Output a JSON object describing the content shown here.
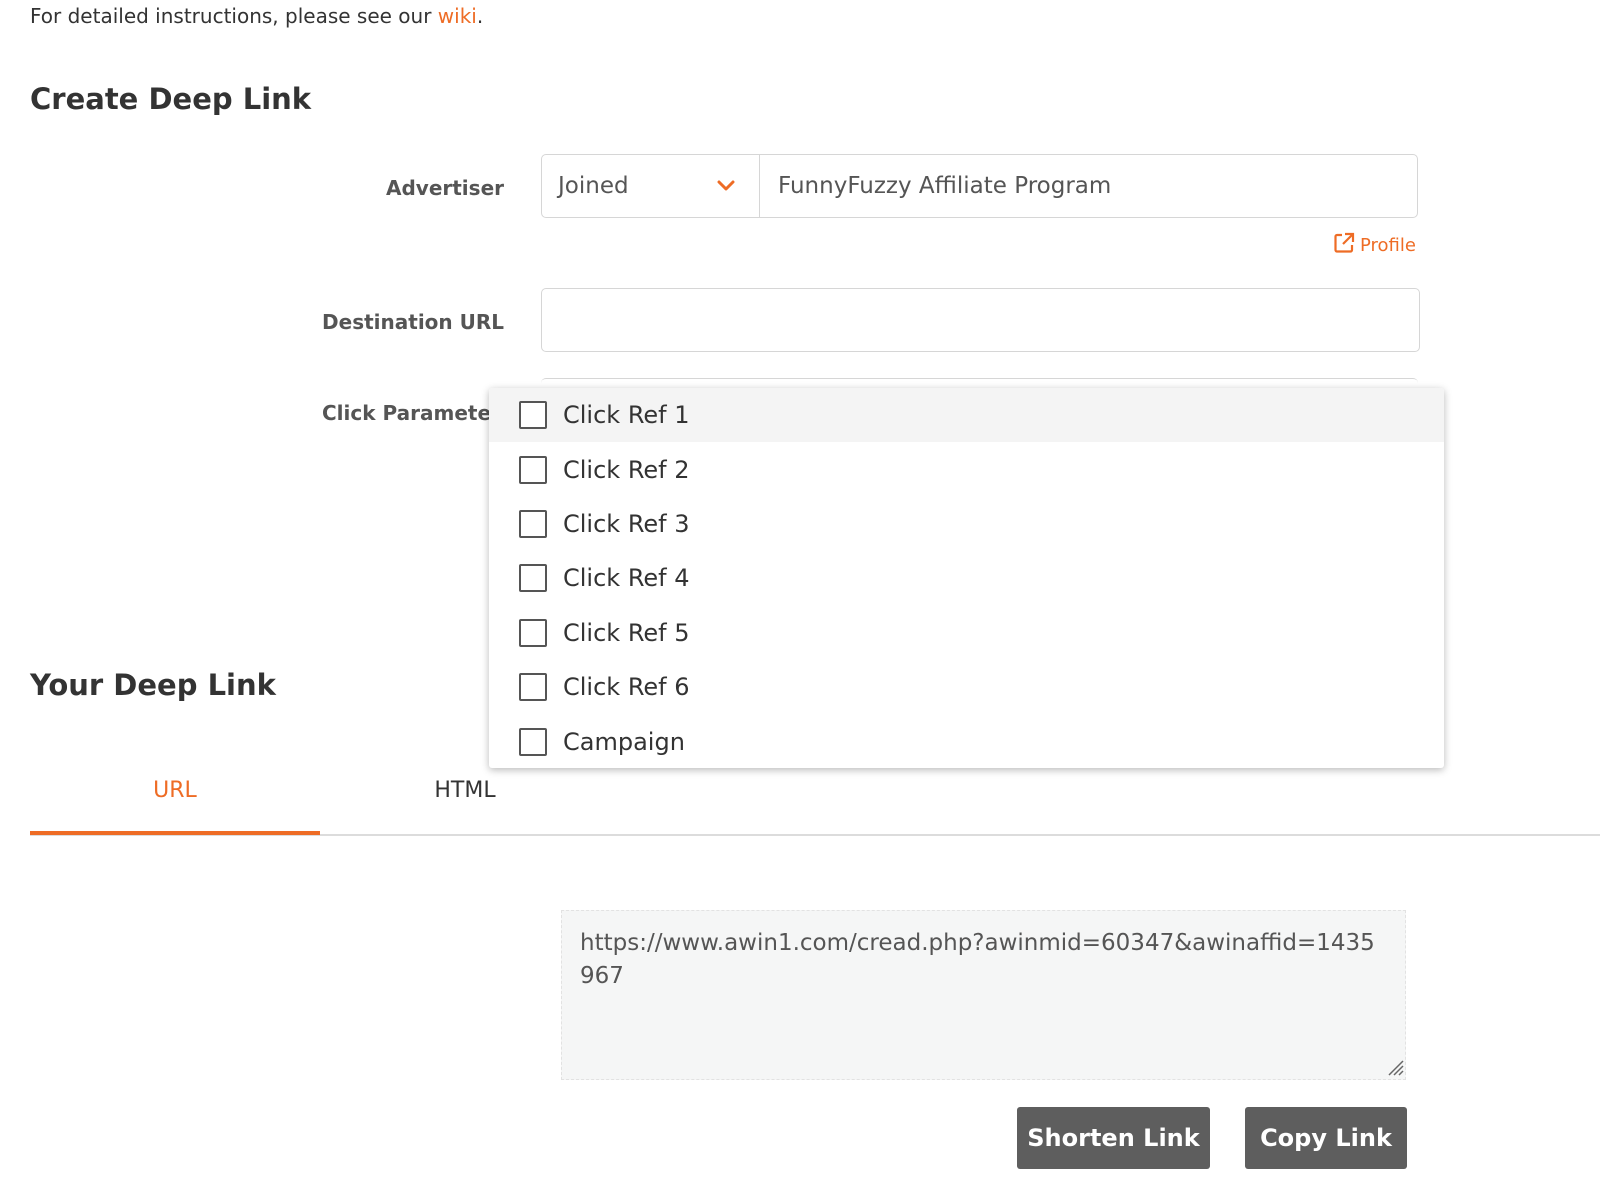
{
  "intro": {
    "text": "For detailed instructions, please see our ",
    "link": "wiki",
    "suffix": "."
  },
  "create_section": {
    "title": "Create Deep Link"
  },
  "advertiser": {
    "label": "Advertiser",
    "filter_value": "Joined",
    "program": "FunnyFuzzy Affiliate Program",
    "profile_link": "Profile"
  },
  "destination": {
    "label": "Destination URL",
    "value": "",
    "placeholder": ""
  },
  "click_params": {
    "label": "Click Parameter",
    "options": [
      {
        "label": "Click Ref 1",
        "checked": false
      },
      {
        "label": "Click Ref 2",
        "checked": false
      },
      {
        "label": "Click Ref 3",
        "checked": false
      },
      {
        "label": "Click Ref 4",
        "checked": false
      },
      {
        "label": "Click Ref 5",
        "checked": false
      },
      {
        "label": "Click Ref 6",
        "checked": false
      },
      {
        "label": "Campaign",
        "checked": false
      }
    ]
  },
  "deep_link": {
    "title": "Your Deep Link",
    "tabs": [
      {
        "label": "URL",
        "active": true
      },
      {
        "label": "HTML",
        "active": false
      }
    ],
    "url": "https://www.awin1.com/cread.php?awinmid=60347&awinaffid=1435967",
    "shorten_label": "Shorten Link",
    "copy_label": "Copy Link"
  },
  "colors": {
    "accent": "#ee6c25",
    "button": "#5e5e5e",
    "text": "#333333"
  },
  "icons": {
    "chevron": "chevron-down-icon",
    "external": "external-link-icon",
    "resize": "resize-grip-icon"
  }
}
